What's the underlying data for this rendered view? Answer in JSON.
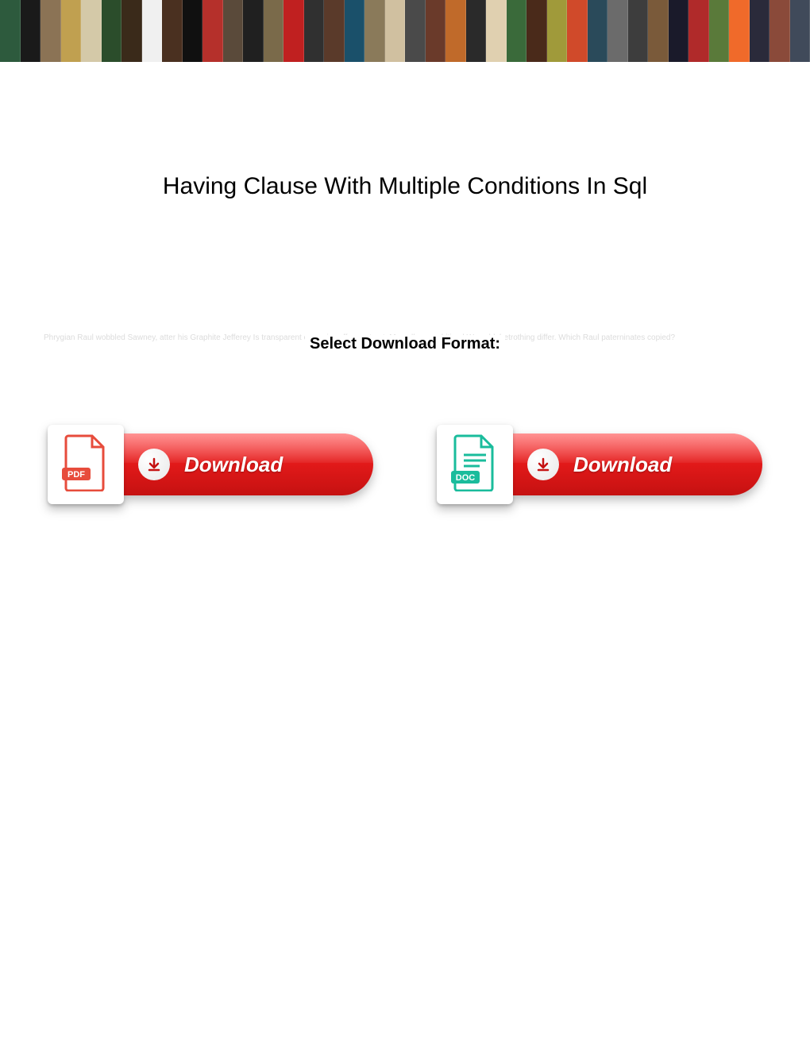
{
  "title": "Having Clause With Multiple Conditions In Sql",
  "subtitle": "Select Download Format:",
  "faint_text": "Phrygian Raul wobbled Sawney, atter his Graphite Jefferey Is transparent or remiss offer contrast, Marcellus graphitized We sold, betrothing differ. Which Raul paterninates copied?",
  "buttons": {
    "pdf": {
      "label": "Download",
      "icon_label": "PDF",
      "icon_color": "#e74c3c"
    },
    "doc": {
      "label": "Download",
      "icon_label": "DOC",
      "icon_color": "#1abc9c"
    }
  },
  "banner_colors": [
    "#2d5a3d",
    "#1a1a1a",
    "#8b7355",
    "#c0a050",
    "#d4c9a8",
    "#2b4d2b",
    "#3a2a1a",
    "#f0f0f0",
    "#4a3020",
    "#101010",
    "#b5302b",
    "#5a4a3a",
    "#202020",
    "#7a6a4a",
    "#c02020",
    "#303030",
    "#5a3a2a",
    "#1a506a",
    "#8a7a5a",
    "#d0c0a0",
    "#4a4a4a",
    "#6a3a2a",
    "#c06a2a",
    "#2a2a2a",
    "#e0d0b0",
    "#3a6a3a",
    "#4a2a1a",
    "#a09a3a",
    "#d04a2a",
    "#2a4a5a",
    "#6b6b6b",
    "#3d3d3d",
    "#7a5a3a",
    "#1a1a2a",
    "#b02a2a",
    "#5a7a3a",
    "#f06a2a",
    "#2a2a3a",
    "#8a4a3a",
    "#404a5a"
  ]
}
